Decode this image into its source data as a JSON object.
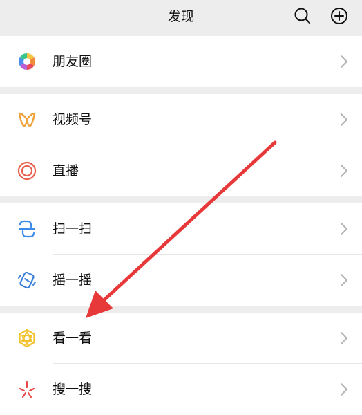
{
  "header": {
    "title": "发现",
    "search_icon": "search-icon",
    "add_icon": "plus-circle-icon"
  },
  "groups": [
    {
      "items": [
        {
          "label": "朋友圈",
          "icon": "moments-aperture-icon"
        }
      ]
    },
    {
      "items": [
        {
          "label": "视频号",
          "icon": "channels-butterfly-icon"
        },
        {
          "label": "直播",
          "icon": "live-ring-icon"
        }
      ]
    },
    {
      "items": [
        {
          "label": "扫一扫",
          "icon": "scan-icon"
        },
        {
          "label": "摇一摇",
          "icon": "shake-icon"
        }
      ]
    },
    {
      "items": [
        {
          "label": "看一看",
          "icon": "top-stories-icon"
        },
        {
          "label": "搜一搜",
          "icon": "search-sparkle-icon"
        }
      ]
    }
  ],
  "annotation": {
    "arrow_color": "#e8393a",
    "points_to": "看一看"
  },
  "colors": {
    "background": "#ededed",
    "row_background": "#ffffff",
    "text": "#111111",
    "chevron": "#b2b2b2"
  }
}
